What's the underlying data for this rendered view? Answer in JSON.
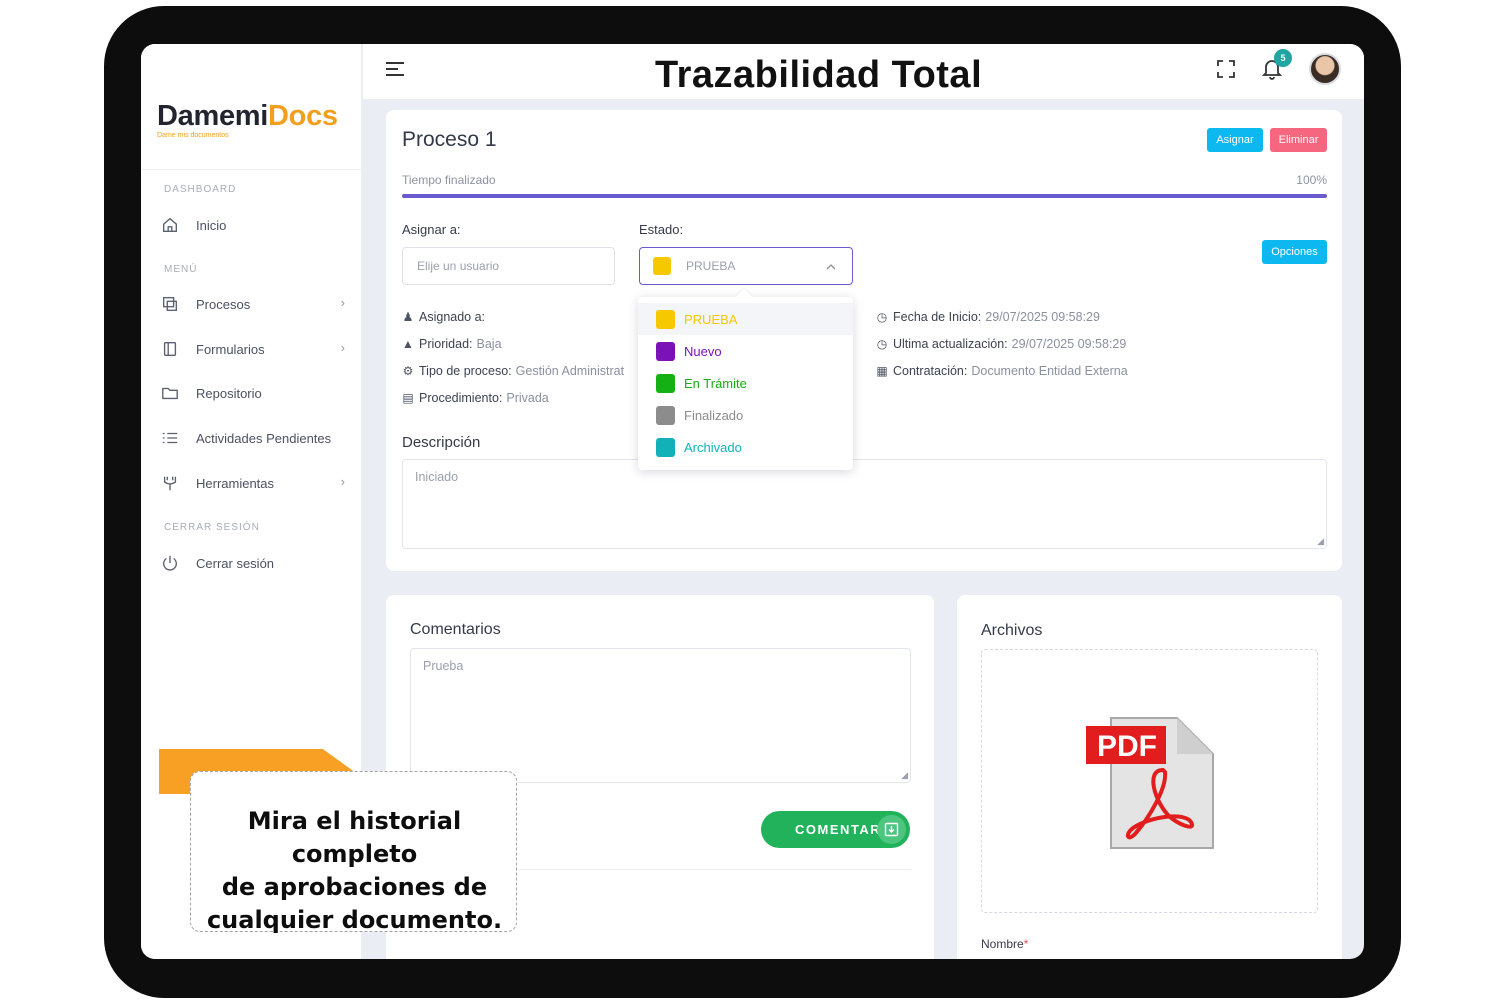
{
  "header": {
    "title": "Trazabilidad Total",
    "notifications_count": "5"
  },
  "brand": {
    "name_a": "Damemi",
    "name_b": "Docs",
    "tagline": "Dame mis documentos",
    "accent": "#f29f1f"
  },
  "sidebar": {
    "sections": {
      "dashboard": "DASHBOARD",
      "menu": "MENÚ",
      "logout": "CERRAR SESIÓN"
    },
    "items": [
      {
        "label": "Inicio",
        "icon": "home-icon"
      },
      {
        "label": "Procesos",
        "icon": "copy-icon",
        "chevron": "›"
      },
      {
        "label": "Formularios",
        "icon": "book-icon",
        "chevron": "›"
      },
      {
        "label": "Repositorio",
        "icon": "folder-icon"
      },
      {
        "label": "Actividades Pendientes",
        "icon": "list-icon"
      },
      {
        "label": "Herramientas",
        "icon": "tools-icon",
        "chevron": "›"
      },
      {
        "label": "Cerrar sesión",
        "icon": "power-icon"
      }
    ]
  },
  "process": {
    "title": "Proceso 1",
    "assign_button": "Asignar",
    "delete_button": "Eliminar",
    "progress_label": "Tiempo finalizado",
    "progress_value": "100%",
    "progress_fraction": 1.0,
    "assign_label": "Asignar a:",
    "assign_placeholder": "Elije un usuario",
    "state_label": "Estado:",
    "state_selected": "PRUEBA",
    "options_button": "Opciones",
    "assigned_label": "Asignado a:",
    "assigned_value": "",
    "priority_label": "Prioridad:",
    "priority_value": "Baja",
    "type_label": "Tipo de proceso:",
    "type_value": "Gestión Administrat",
    "procedure_label": "Procedimiento:",
    "procedure_value": "Privada",
    "start_label": "Fecha de Inicio:",
    "start_value": "29/07/2025 09:58:29",
    "updated_label": "Ultima actualización:",
    "updated_value": "29/07/2025 09:58:29",
    "contract_label": "Contratación:",
    "contract_value": "Documento Entidad Externa",
    "description_title": "Descripción",
    "description_text": "Iniciado"
  },
  "state_options": [
    {
      "label": "PRUEBA",
      "color": "#f5c800"
    },
    {
      "label": "Nuevo",
      "color": "#7b12b8"
    },
    {
      "label": "En Trámite",
      "color": "#14b014"
    },
    {
      "label": "Finalizado",
      "color": "#8c8c8c"
    },
    {
      "label": "Archivado",
      "color": "#12b1b8"
    }
  ],
  "comments": {
    "title": "Comentarios",
    "text": "Prueba",
    "button": "COMENTAR"
  },
  "files": {
    "title": "Archivos",
    "file_icon": "pdf-file-icon",
    "pdf_label": "PDF",
    "name_label": "Nombre",
    "required_mark": "*"
  },
  "callout": {
    "line1": "Mira el historial completo",
    "line2": "de aprobaciones de",
    "line3": "cualquier documento."
  }
}
